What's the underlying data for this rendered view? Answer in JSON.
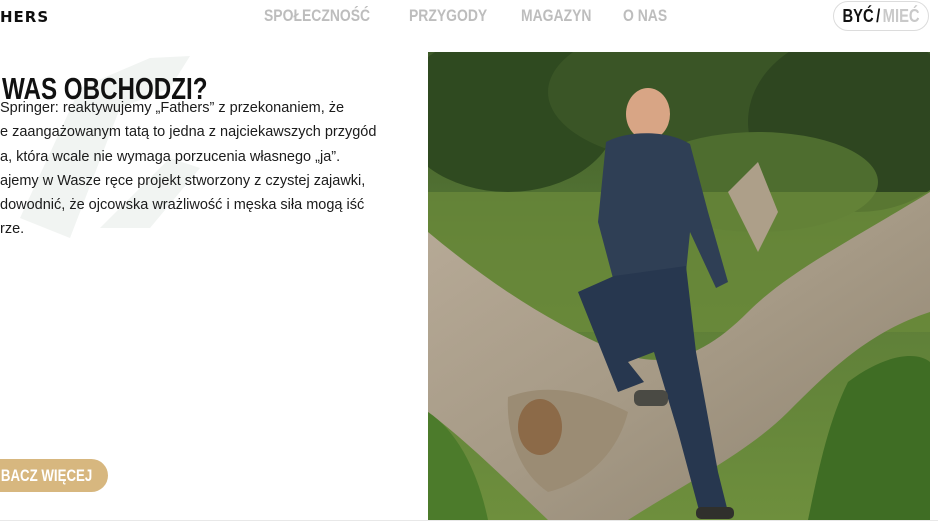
{
  "header": {
    "logo_text": "HERS",
    "nav": [
      "SPOŁECZNOŚĆ",
      "PRZYGODY",
      "MAGAZYN",
      "O NAS"
    ],
    "toggle": {
      "active": "BYĆ",
      "separator": "/",
      "inactive": "MIEĆ"
    }
  },
  "content": {
    "heading": "WAS OBCHODZI?",
    "paragraph_lines": [
      "Springer: reaktywujemy „Fathers” z przekonaniem, że",
      "e zaangażowanym tatą to jedna z najciekawszych przygód",
      "a, która wcale nie wymaga porzucenia własnego „ja”.",
      "ajemy w Wasze ręce projekt stworzony z czystej zajawki,",
      "dowodnić, że ojcowska wrażliwość i męska siła mogą iść",
      "rze."
    ],
    "cta_label": "BACZ WIĘCEJ",
    "cta_icon": "arrow-right-icon"
  },
  "colors": {
    "accent": "#d7b77f",
    "nav_inactive": "#bdbdbd",
    "text": "#111111"
  }
}
